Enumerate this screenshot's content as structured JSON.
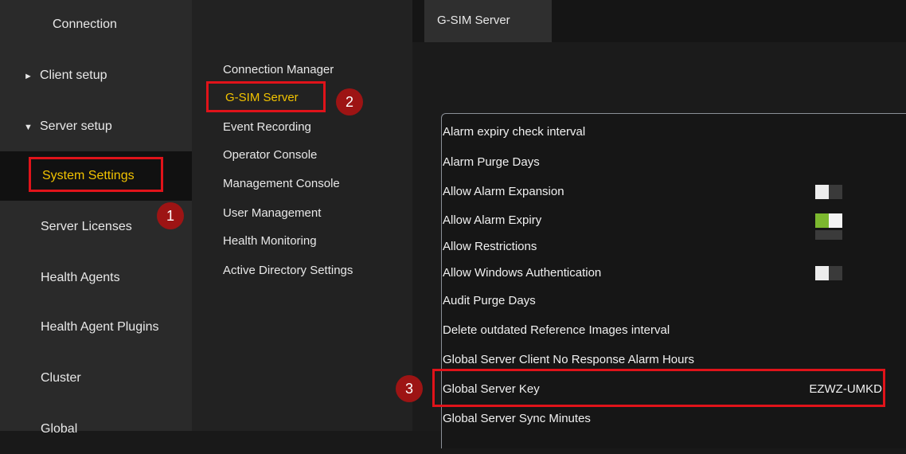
{
  "left_nav": [
    {
      "label": "Connection",
      "arrow": ""
    },
    {
      "label": "Client setup",
      "arrow": "►"
    },
    {
      "label": "Server setup",
      "arrow": "▼"
    },
    {
      "label": "System Settings",
      "arrow": ""
    },
    {
      "label": "Server Licenses",
      "arrow": ""
    },
    {
      "label": "Health Agents",
      "arrow": ""
    },
    {
      "label": "Health Agent Plugins",
      "arrow": ""
    },
    {
      "label": "Cluster",
      "arrow": ""
    },
    {
      "label": "Global",
      "arrow": ""
    }
  ],
  "submenu": [
    {
      "label": "Connection Manager"
    },
    {
      "label": "G-SIM Server"
    },
    {
      "label": "Event Recording"
    },
    {
      "label": "Operator Console"
    },
    {
      "label": "Management Console"
    },
    {
      "label": "User Management"
    },
    {
      "label": "Health Monitoring"
    },
    {
      "label": "Active Directory Settings"
    }
  ],
  "tab": {
    "label": "G-SIM Server"
  },
  "properties": [
    {
      "name": "Alarm expiry check interval",
      "value": ""
    },
    {
      "name": "Alarm Purge Days",
      "value": ""
    },
    {
      "name": "Allow Alarm Expansion",
      "value": ""
    },
    {
      "name": "Allow Alarm Expiry",
      "value": ""
    },
    {
      "name": "Allow Restrictions",
      "value": ""
    },
    {
      "name": "Allow Windows Authentication",
      "value": ""
    },
    {
      "name": "Audit Purge Days",
      "value": ""
    },
    {
      "name": "Delete outdated Reference Images interval",
      "value": ""
    },
    {
      "name": "Global Server Client No Response Alarm Hours",
      "value": ""
    },
    {
      "name": "Global Server Key",
      "value": "EZWZ-UMKD"
    },
    {
      "name": "Global Server Sync Minutes",
      "value": ""
    }
  ],
  "toggles": {
    "allow_alarm_expansion": false,
    "allow_alarm_expiry": true,
    "allow_windows_authentication": false
  },
  "badges": {
    "one": "1",
    "two": "2",
    "three": "3"
  },
  "colors": {
    "accent_active": "#f2c300",
    "annotation_red": "#e0131a",
    "badge_red": "#9d1414",
    "toggle_on": "#7cb82f"
  }
}
